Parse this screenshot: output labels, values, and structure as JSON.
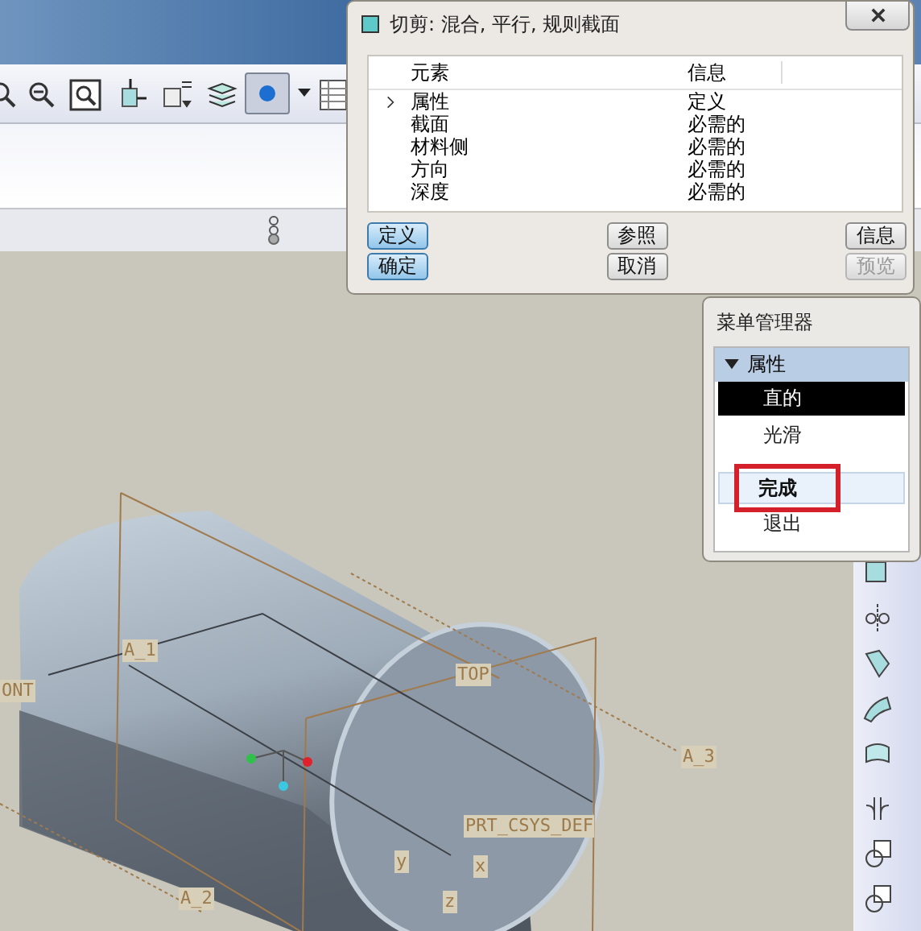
{
  "dialog": {
    "title": "切剪: 混合, 平行, 规则截面",
    "columns": [
      "元素",
      "信息"
    ],
    "rows": [
      {
        "element": "属性",
        "info": "定义",
        "selected": true
      },
      {
        "element": "截面",
        "info": "必需的",
        "selected": false
      },
      {
        "element": "材料侧",
        "info": "必需的",
        "selected": false
      },
      {
        "element": "方向",
        "info": "必需的",
        "selected": false
      },
      {
        "element": "深度",
        "info": "必需的",
        "selected": false
      }
    ],
    "buttons": [
      {
        "label": "定义",
        "highlighted": true,
        "disabled": false
      },
      {
        "label": "参照",
        "highlighted": false,
        "disabled": false
      },
      {
        "label": "信息",
        "highlighted": false,
        "disabled": false
      },
      {
        "label": "确定",
        "highlighted": true,
        "disabled": false
      },
      {
        "label": "取消",
        "highlighted": false,
        "disabled": false
      },
      {
        "label": "预览",
        "highlighted": false,
        "disabled": true
      }
    ]
  },
  "menu_manager": {
    "title": "菜单管理器",
    "section": {
      "label": "属性",
      "expanded": true
    },
    "items": [
      {
        "kind": "option",
        "label": "直的",
        "selected": true
      },
      {
        "kind": "option",
        "label": "光滑",
        "selected": false
      },
      {
        "kind": "button",
        "label": "完成",
        "marked": true
      },
      {
        "kind": "plain",
        "label": "退出"
      }
    ]
  },
  "viewport": {
    "labels": [
      "A_1",
      "ONT",
      "TOP",
      "A_3",
      "PRT_CSYS_DEF",
      "y",
      "x",
      "z",
      "A_2"
    ]
  }
}
